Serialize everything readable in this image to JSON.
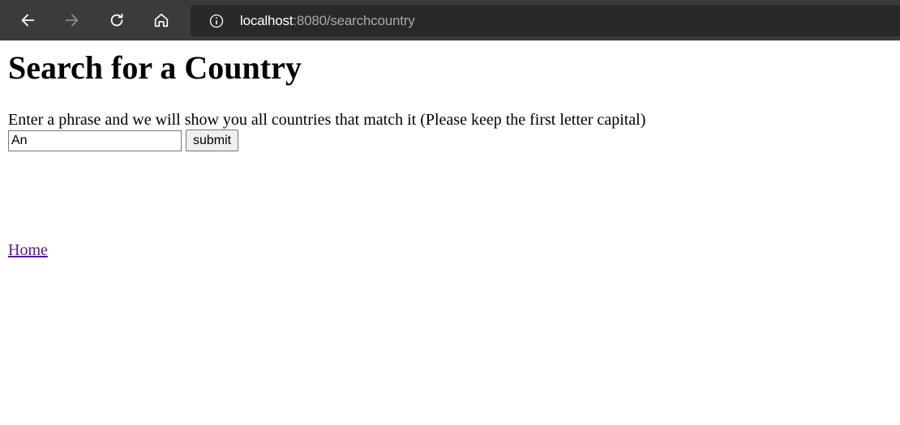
{
  "browser": {
    "url_host": "localhost",
    "url_rest": ":8080/searchcountry",
    "icons": {
      "back": "arrow-left-icon",
      "forward": "arrow-right-icon",
      "reload": "reload-icon",
      "home": "home-icon",
      "info": "info-icon"
    }
  },
  "page": {
    "title": "Search for a Country",
    "prompt": "Enter a phrase and we will show you all countries that match it (Please keep the first letter capital)",
    "search_value": "An",
    "submit_label": "submit",
    "home_link": "Home"
  },
  "colors": {
    "toolbar": "#3b3b3b",
    "address_bar": "#292929",
    "visited_link": "#551a8b"
  }
}
